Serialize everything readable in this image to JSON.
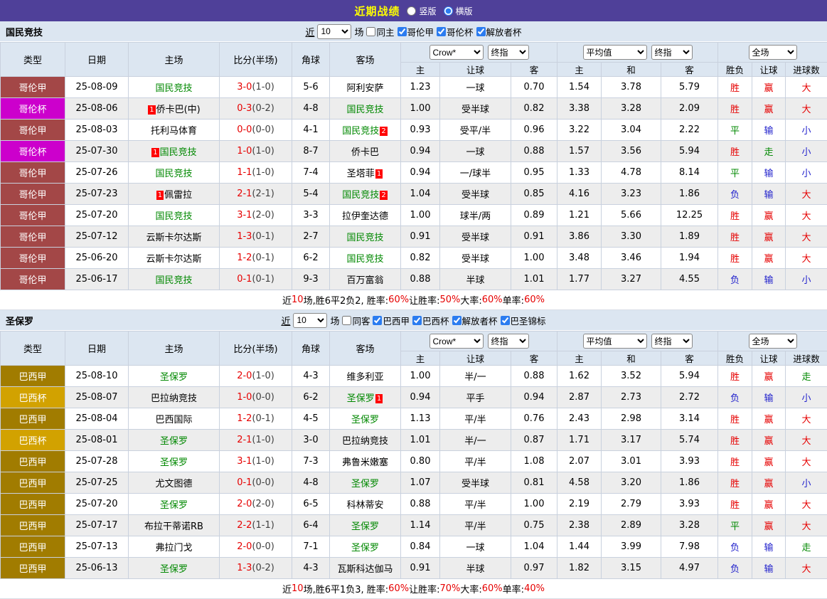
{
  "topbar": {
    "title": "近期战绩",
    "radio_vertical": "竖版",
    "radio_horizontal": "横版",
    "selected": "横版"
  },
  "columns": {
    "main": [
      "类型",
      "日期",
      "主场",
      "比分(半场)",
      "角球",
      "客场"
    ],
    "sub": [
      "主",
      "让球",
      "客",
      "主",
      "和",
      "客",
      "胜负",
      "让球",
      "进球数"
    ],
    "selects": {
      "bookmaker": "Crow*",
      "final_a": "终指",
      "average": "平均值",
      "final_b": "终指",
      "scope": "全场"
    }
  },
  "colors": {
    "topbar": "#4f4099",
    "title_yellow": "#ffff00",
    "header_bg": "#dce6f1",
    "row_alt": "#ededed",
    "cream_col": "#faf5ea",
    "blue_col": "#e7f2f8",
    "border": "#c9d1de",
    "red": "#e60000",
    "green": "#008800",
    "blue": "#2222cc",
    "badge_red": "#ff0000",
    "score_half": "#404040",
    "team_green": "#008800",
    "accent": "#2b7cf0"
  },
  "league_colors": {
    "哥伦甲": "#a34747",
    "哥伦杯": "#cc00cc",
    "巴西甲": "#a17c00",
    "巴西杯": "#d2a200"
  },
  "sections": [
    {
      "team": "国民竞技",
      "filters": {
        "near": "近",
        "count": "10",
        "games": "场",
        "same": {
          "label": "同主",
          "checked": false
        },
        "leagues": [
          {
            "label": "哥伦甲",
            "checked": true
          },
          {
            "label": "哥伦杯",
            "checked": true
          },
          {
            "label": "解放者杯",
            "checked": true
          }
        ]
      },
      "rows": [
        {
          "league": "哥伦甲",
          "date": "25-08-09",
          "home": {
            "n": "国民竞技",
            "t": 1
          },
          "score": {
            "f": "3-0",
            "h": "1-0"
          },
          "corner": "5-6",
          "away": {
            "n": "阿利安萨"
          },
          "odds": [
            "1.23",
            "一球",
            "0.70"
          ],
          "avg": [
            "1.54",
            "3.78",
            "5.79"
          ],
          "res": [
            "胜",
            "赢",
            "大"
          ]
        },
        {
          "league": "哥伦杯",
          "date": "25-08-06",
          "home": {
            "n": "侨卡巴(中)",
            "b": "1",
            "bp": "before"
          },
          "score": {
            "f": "0-3",
            "h": "0-2"
          },
          "corner": "4-8",
          "away": {
            "n": "国民竞技",
            "t": 1
          },
          "odds": [
            "1.00",
            "受半球",
            "0.82"
          ],
          "avg": [
            "3.38",
            "3.28",
            "2.09"
          ],
          "res": [
            "胜",
            "赢",
            "大"
          ]
        },
        {
          "league": "哥伦甲",
          "date": "25-08-03",
          "home": {
            "n": "托利马体育"
          },
          "score": {
            "f": "0-0",
            "h": "0-0"
          },
          "corner": "4-1",
          "away": {
            "n": "国民竞技",
            "t": 1,
            "b": "2",
            "bp": "after"
          },
          "odds": [
            "0.93",
            "受平/半",
            "0.96"
          ],
          "avg": [
            "3.22",
            "3.04",
            "2.22"
          ],
          "res": [
            "平",
            "输",
            "小"
          ]
        },
        {
          "league": "哥伦杯",
          "date": "25-07-30",
          "home": {
            "n": "国民竞技",
            "t": 1,
            "b": "1",
            "bp": "before"
          },
          "score": {
            "f": "1-0",
            "h": "1-0"
          },
          "corner": "8-7",
          "away": {
            "n": "侨卡巴"
          },
          "odds": [
            "0.94",
            "一球",
            "0.88"
          ],
          "avg": [
            "1.57",
            "3.56",
            "5.94"
          ],
          "res": [
            "胜",
            "走",
            "小"
          ]
        },
        {
          "league": "哥伦甲",
          "date": "25-07-26",
          "home": {
            "n": "国民竞技",
            "t": 1
          },
          "score": {
            "f": "1-1",
            "h": "1-0"
          },
          "corner": "7-4",
          "away": {
            "n": "圣塔菲",
            "b": "1",
            "bp": "after"
          },
          "odds": [
            "0.94",
            "一/球半",
            "0.95"
          ],
          "avg": [
            "1.33",
            "4.78",
            "8.14"
          ],
          "res": [
            "平",
            "输",
            "小"
          ]
        },
        {
          "league": "哥伦甲",
          "date": "25-07-23",
          "home": {
            "n": "佩雷拉",
            "b": "1",
            "bp": "before"
          },
          "score": {
            "f": "2-1",
            "h": "2-1"
          },
          "corner": "5-4",
          "away": {
            "n": "国民竞技",
            "t": 1,
            "b": "2",
            "bp": "after"
          },
          "odds": [
            "1.04",
            "受半球",
            "0.85"
          ],
          "avg": [
            "4.16",
            "3.23",
            "1.86"
          ],
          "res": [
            "负",
            "输",
            "大"
          ]
        },
        {
          "league": "哥伦甲",
          "date": "25-07-20",
          "home": {
            "n": "国民竞技",
            "t": 1
          },
          "score": {
            "f": "3-1",
            "h": "2-0"
          },
          "corner": "3-3",
          "away": {
            "n": "拉伊奎达德"
          },
          "odds": [
            "1.00",
            "球半/两",
            "0.89"
          ],
          "avg": [
            "1.21",
            "5.66",
            "12.25"
          ],
          "res": [
            "胜",
            "赢",
            "大"
          ]
        },
        {
          "league": "哥伦甲",
          "date": "25-07-12",
          "home": {
            "n": "云斯卡尔达斯"
          },
          "score": {
            "f": "1-3",
            "h": "0-1"
          },
          "corner": "2-7",
          "away": {
            "n": "国民竞技",
            "t": 1
          },
          "odds": [
            "0.91",
            "受半球",
            "0.91"
          ],
          "avg": [
            "3.86",
            "3.30",
            "1.89"
          ],
          "res": [
            "胜",
            "赢",
            "大"
          ]
        },
        {
          "league": "哥伦甲",
          "date": "25-06-20",
          "home": {
            "n": "云斯卡尔达斯"
          },
          "score": {
            "f": "1-2",
            "h": "0-1"
          },
          "corner": "6-2",
          "away": {
            "n": "国民竞技",
            "t": 1
          },
          "odds": [
            "0.82",
            "受半球",
            "1.00"
          ],
          "avg": [
            "3.48",
            "3.46",
            "1.94"
          ],
          "res": [
            "胜",
            "赢",
            "大"
          ]
        },
        {
          "league": "哥伦甲",
          "date": "25-06-17",
          "home": {
            "n": "国民竞技",
            "t": 1
          },
          "score": {
            "f": "0-1",
            "h": "0-1"
          },
          "corner": "9-3",
          "away": {
            "n": "百万富翁"
          },
          "odds": [
            "0.88",
            "半球",
            "1.01"
          ],
          "avg": [
            "1.77",
            "3.27",
            "4.55"
          ],
          "res": [
            "负",
            "输",
            "小"
          ]
        }
      ],
      "summary": [
        {
          "t": "近"
        },
        {
          "t": "10",
          "red": true
        },
        {
          "t": "场,胜6平2负2, 胜率:"
        },
        {
          "t": "60%",
          "red": true
        },
        {
          "t": " 让胜率:"
        },
        {
          "t": "50%",
          "red": true
        },
        {
          "t": " 大率:"
        },
        {
          "t": "60%",
          "red": true
        },
        {
          "t": " 单率:"
        },
        {
          "t": "60%",
          "red": true
        }
      ]
    },
    {
      "team": "圣保罗",
      "filters": {
        "near": "近",
        "count": "10",
        "games": "场",
        "same": {
          "label": "同客",
          "checked": false
        },
        "leagues": [
          {
            "label": "巴西甲",
            "checked": true
          },
          {
            "label": "巴西杯",
            "checked": true
          },
          {
            "label": "解放者杯",
            "checked": true
          },
          {
            "label": "巴圣锦标",
            "checked": true
          }
        ]
      },
      "rows": [
        {
          "league": "巴西甲",
          "date": "25-08-10",
          "home": {
            "n": "圣保罗",
            "t": 1
          },
          "score": {
            "f": "2-0",
            "h": "1-0"
          },
          "corner": "4-3",
          "away": {
            "n": "维多利亚"
          },
          "odds": [
            "1.00",
            "半/一",
            "0.88"
          ],
          "avg": [
            "1.62",
            "3.52",
            "5.94"
          ],
          "res": [
            "胜",
            "赢",
            "走"
          ]
        },
        {
          "league": "巴西杯",
          "date": "25-08-07",
          "home": {
            "n": "巴拉纳竞技"
          },
          "score": {
            "f": "1-0",
            "h": "0-0"
          },
          "corner": "6-2",
          "away": {
            "n": "圣保罗",
            "t": 1,
            "b": "1",
            "bp": "after"
          },
          "odds": [
            "0.94",
            "平手",
            "0.94"
          ],
          "avg": [
            "2.87",
            "2.73",
            "2.72"
          ],
          "res": [
            "负",
            "输",
            "小"
          ]
        },
        {
          "league": "巴西甲",
          "date": "25-08-04",
          "home": {
            "n": "巴西国际"
          },
          "score": {
            "f": "1-2",
            "h": "0-1"
          },
          "corner": "4-5",
          "away": {
            "n": "圣保罗",
            "t": 1
          },
          "odds": [
            "1.13",
            "平/半",
            "0.76"
          ],
          "avg": [
            "2.43",
            "2.98",
            "3.14"
          ],
          "res": [
            "胜",
            "赢",
            "大"
          ]
        },
        {
          "league": "巴西杯",
          "date": "25-08-01",
          "home": {
            "n": "圣保罗",
            "t": 1
          },
          "score": {
            "f": "2-1",
            "h": "1-0"
          },
          "corner": "3-0",
          "away": {
            "n": "巴拉纳竞技"
          },
          "odds": [
            "1.01",
            "半/一",
            "0.87"
          ],
          "avg": [
            "1.71",
            "3.17",
            "5.74"
          ],
          "res": [
            "胜",
            "赢",
            "大"
          ]
        },
        {
          "league": "巴西甲",
          "date": "25-07-28",
          "home": {
            "n": "圣保罗",
            "t": 1
          },
          "score": {
            "f": "3-1",
            "h": "1-0"
          },
          "corner": "7-3",
          "away": {
            "n": "弗鲁米嫩塞"
          },
          "odds": [
            "0.80",
            "平/半",
            "1.08"
          ],
          "avg": [
            "2.07",
            "3.01",
            "3.93"
          ],
          "res": [
            "胜",
            "赢",
            "大"
          ]
        },
        {
          "league": "巴西甲",
          "date": "25-07-25",
          "home": {
            "n": "尤文图德"
          },
          "score": {
            "f": "0-1",
            "h": "0-0"
          },
          "corner": "4-8",
          "away": {
            "n": "圣保罗",
            "t": 1
          },
          "odds": [
            "1.07",
            "受半球",
            "0.81"
          ],
          "avg": [
            "4.58",
            "3.20",
            "1.86"
          ],
          "res": [
            "胜",
            "赢",
            "小"
          ]
        },
        {
          "league": "巴西甲",
          "date": "25-07-20",
          "home": {
            "n": "圣保罗",
            "t": 1
          },
          "score": {
            "f": "2-0",
            "h": "2-0"
          },
          "corner": "6-5",
          "away": {
            "n": "科林蒂安"
          },
          "odds": [
            "0.88",
            "平/半",
            "1.00"
          ],
          "avg": [
            "2.19",
            "2.79",
            "3.93"
          ],
          "res": [
            "胜",
            "赢",
            "大"
          ]
        },
        {
          "league": "巴西甲",
          "date": "25-07-17",
          "home": {
            "n": "布拉干蒂诺RB"
          },
          "score": {
            "f": "2-2",
            "h": "1-1"
          },
          "corner": "6-4",
          "away": {
            "n": "圣保罗",
            "t": 1
          },
          "odds": [
            "1.14",
            "平/半",
            "0.75"
          ],
          "avg": [
            "2.38",
            "2.89",
            "3.28"
          ],
          "res": [
            "平",
            "赢",
            "大"
          ]
        },
        {
          "league": "巴西甲",
          "date": "25-07-13",
          "home": {
            "n": "弗拉门戈"
          },
          "score": {
            "f": "2-0",
            "h": "0-0"
          },
          "corner": "7-1",
          "away": {
            "n": "圣保罗",
            "t": 1
          },
          "odds": [
            "0.84",
            "一球",
            "1.04"
          ],
          "avg": [
            "1.44",
            "3.99",
            "7.98"
          ],
          "res": [
            "负",
            "输",
            "走"
          ]
        },
        {
          "league": "巴西甲",
          "date": "25-06-13",
          "home": {
            "n": "圣保罗",
            "t": 1
          },
          "score": {
            "f": "1-3",
            "h": "0-2"
          },
          "corner": "4-3",
          "away": {
            "n": "瓦斯科达伽马"
          },
          "odds": [
            "0.91",
            "半球",
            "0.97"
          ],
          "avg": [
            "1.82",
            "3.15",
            "4.97"
          ],
          "res": [
            "负",
            "输",
            "大"
          ]
        }
      ],
      "summary": [
        {
          "t": "近"
        },
        {
          "t": "10",
          "red": true
        },
        {
          "t": "场,胜6平1负3, 胜率:"
        },
        {
          "t": "60%",
          "red": true
        },
        {
          "t": " 让胜率:"
        },
        {
          "t": "70%",
          "red": true
        },
        {
          "t": " 大率:"
        },
        {
          "t": "60%",
          "red": true
        },
        {
          "t": " 单率:"
        },
        {
          "t": "40%",
          "red": true
        }
      ]
    }
  ]
}
